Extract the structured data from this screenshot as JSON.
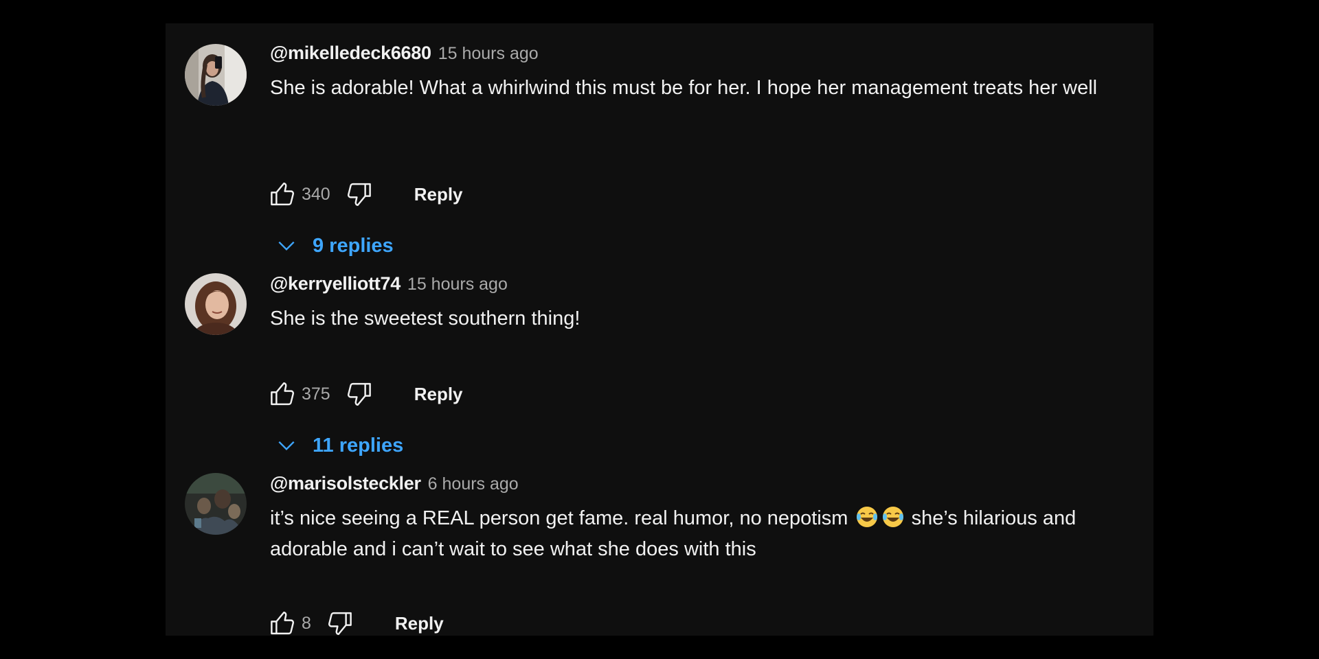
{
  "comments": [
    {
      "author": "@mikelledeck6680",
      "time": "15 hours ago",
      "text": "She is adorable! What a whirlwind this must be for her. I hope her management treats her well",
      "likes": "340",
      "reply_label": "Reply",
      "replies_label": "9 replies",
      "avatar_icon": "avatar-photo-selfie"
    },
    {
      "author": "@kerryelliott74",
      "time": "15 hours ago",
      "text": "She is the sweetest southern thing!",
      "likes": "375",
      "reply_label": "Reply",
      "replies_label": "11 replies",
      "avatar_icon": "avatar-photo-portrait"
    },
    {
      "author": "@marisolsteckler",
      "time": "6 hours ago",
      "text_before_emoji": "it’s nice seeing a REAL person get fame. real humor, no nepotism ",
      "emojis": [
        "😂",
        "😂"
      ],
      "text_after_emoji": " she’s hilarious and adorable and i can’t wait to see what she does with this",
      "likes": "8",
      "reply_label": "Reply",
      "avatar_icon": "avatar-photo-group"
    }
  ],
  "colors": {
    "background": "#000000",
    "panel": "#0f0f0f",
    "text_primary": "#f1f1f1",
    "text_secondary": "#aaaaaa",
    "link_blue": "#3ea6ff"
  }
}
